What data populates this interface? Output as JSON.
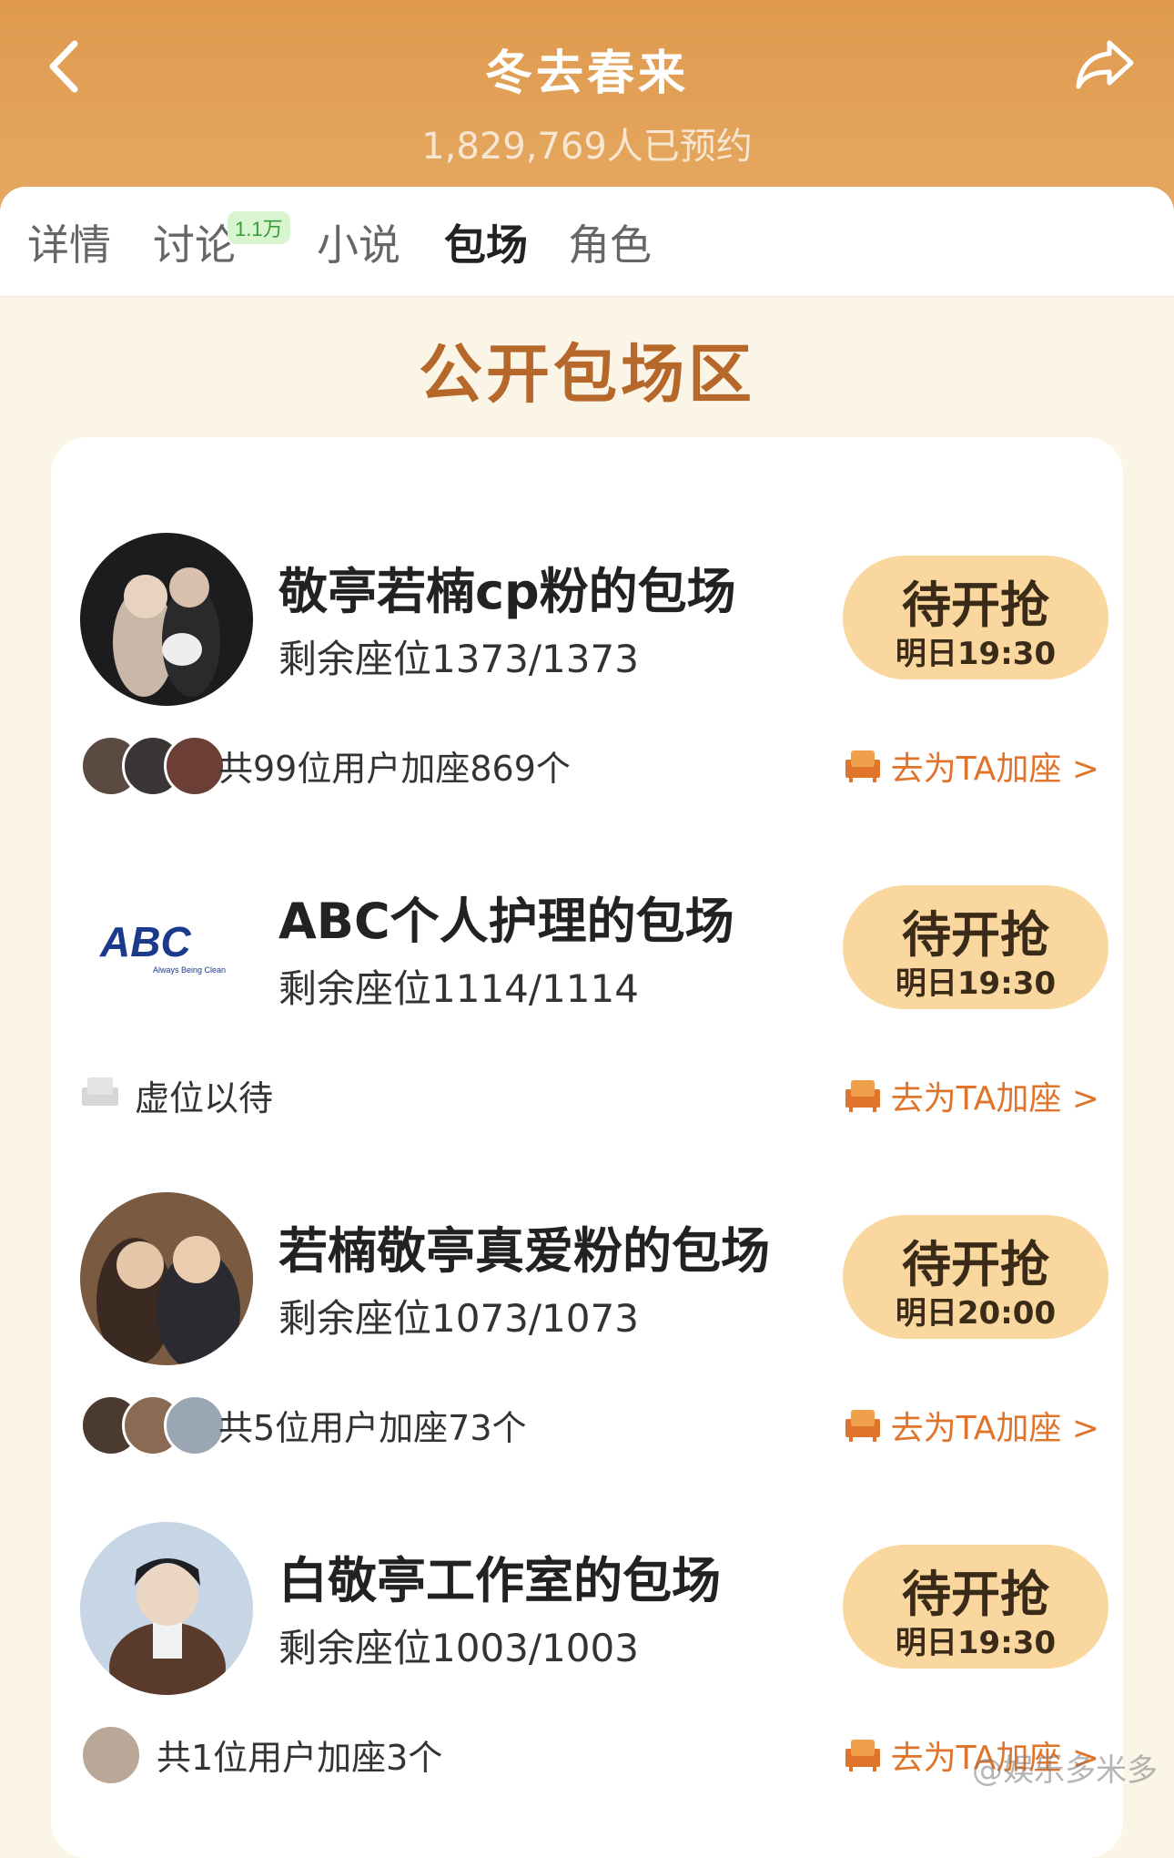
{
  "header": {
    "title": "冬去春来",
    "subtitle": "1,829,769人已预约"
  },
  "tabs": [
    {
      "label": "详情",
      "active": false
    },
    {
      "label": "讨论",
      "active": false,
      "badge": "1.1万"
    },
    {
      "label": "小说",
      "active": false
    },
    {
      "label": "包场",
      "active": true
    },
    {
      "label": "角色",
      "active": false
    }
  ],
  "section_title": "公开包场区",
  "entries": [
    {
      "title": "敬亭若楠cp粉的包场",
      "seats": "剩余座位1373/1373",
      "button_main": "待开抢",
      "button_time": "明日19:30",
      "supporters": "共99位用户加座869个",
      "join_label": "去为TA加座 >"
    },
    {
      "title": "ABC个人护理的包场",
      "seats": "剩余座位1114/1114",
      "button_main": "待开抢",
      "button_time": "明日19:30",
      "supporters": "虚位以待",
      "join_label": "去为TA加座 >",
      "logo_text": "ABC",
      "logo_tagline": "Always Being Clean"
    },
    {
      "title": "若楠敬亭真爱粉的包场",
      "seats": "剩余座位1073/1073",
      "button_main": "待开抢",
      "button_time": "明日20:00",
      "supporters": "共5位用户加座73个",
      "join_label": "去为TA加座 >"
    },
    {
      "title": "白敬亭工作室的包场",
      "seats": "剩余座位1003/1003",
      "button_main": "待开抢",
      "button_time": "明日19:30",
      "supporters": "共1位用户加座3个",
      "join_label": "去为TA加座 >"
    }
  ],
  "watermark": "@娱乐多米多",
  "colors": {
    "header": "#df9a4f",
    "accent": "#e0742a",
    "button": "#fad79e",
    "section_title": "#b5682a"
  },
  "icons": {
    "back": "chevron-left-icon",
    "share": "share-arrow-icon",
    "join": "sofa-icon"
  }
}
